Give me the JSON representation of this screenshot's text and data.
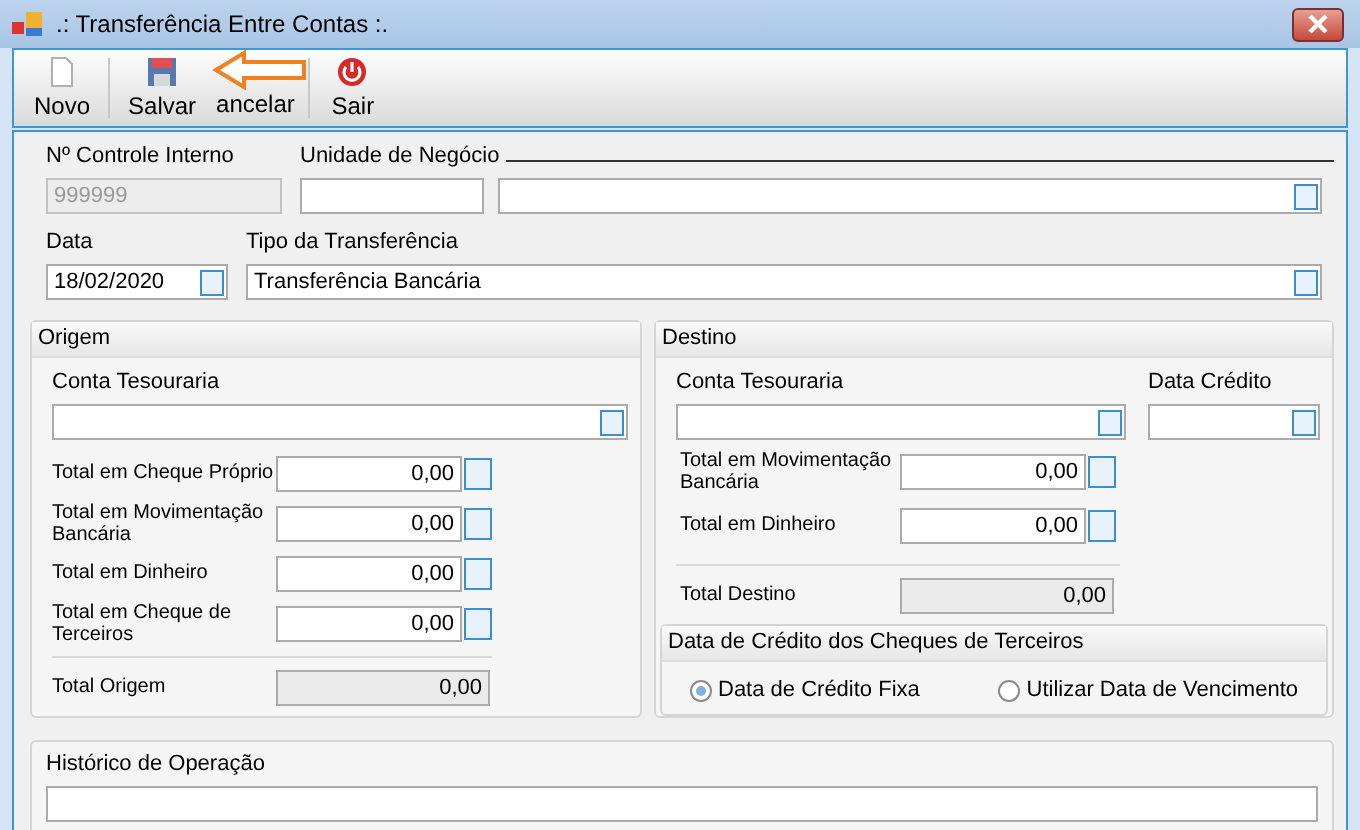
{
  "window": {
    "title": ".: Transferência Entre Contas :."
  },
  "toolbar": [
    {
      "label": "Novo",
      "kind": "new"
    },
    {
      "label": "Salvar",
      "kind": "save"
    },
    {
      "label": "ancelar",
      "kind": "cancel"
    },
    {
      "label": "Sair",
      "kind": "exit"
    }
  ],
  "header": {
    "controle": {
      "label": "Nº Controle Interno",
      "value": "999999",
      "disabled": true
    },
    "unidade": {
      "label": "Unidade de Negócio"
    },
    "data": {
      "label": "Data",
      "value": "18/02/2020"
    },
    "tipo": {
      "label": "Tipo da Transferência",
      "value": "Transferência Bancária"
    }
  },
  "origem": {
    "title": "Origem",
    "conta_label": "Conta Tesouraria",
    "totals": [
      {
        "label": "Total em Cheque Próprio",
        "value": "0,00"
      },
      {
        "label": "Total em Movimentação Bancária",
        "value": "0,00"
      },
      {
        "label": "Total em Dinheiro",
        "value": "0,00"
      },
      {
        "label": "Total em Cheque de Terceiros",
        "value": "0,00"
      }
    ],
    "total": {
      "label": "Total Origem",
      "value": "0,00"
    }
  },
  "destino": {
    "title": "Destino",
    "conta_label": "Conta Tesouraria",
    "data_credito_label": "Data Crédito",
    "totals": [
      {
        "label": "Total em Movimentação Bancária",
        "value": "0,00"
      },
      {
        "label": "Total em Dinheiro",
        "value": "0,00"
      }
    ],
    "total": {
      "label": "Total Destino",
      "value": "0,00"
    },
    "cheques": {
      "title": "Data de Crédito dos Cheques de Terceiros",
      "options": [
        {
          "label": "Data de Crédito Fixa",
          "selected": true
        },
        {
          "label": "Utilizar Data de Vencimento",
          "selected": false
        }
      ]
    }
  },
  "historico": {
    "label": "Histórico de Operação"
  }
}
